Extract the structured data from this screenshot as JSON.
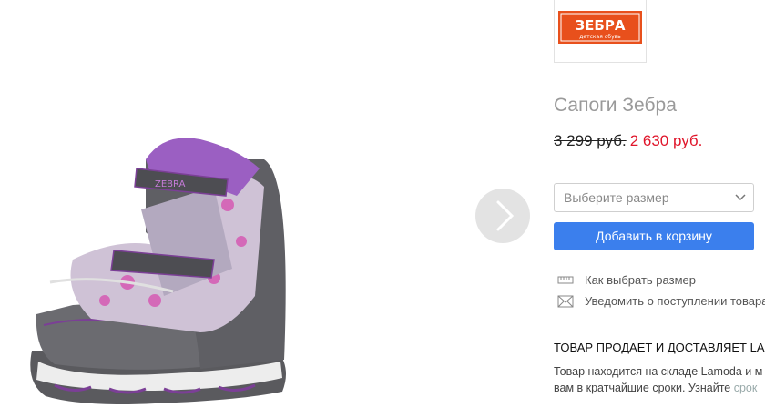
{
  "brand": {
    "logo_text": "ЗЕБРА",
    "logo_sub": "детская обувь"
  },
  "product": {
    "title": "Сапоги Зебра",
    "old_price": "3 299 руб.",
    "new_price": "2 630 руб.",
    "boot_label": "ZEBRA"
  },
  "size_select": {
    "placeholder": "Выберите размер"
  },
  "cart_button": {
    "label": "Добавить в корзину"
  },
  "links": [
    {
      "icon": "ruler-icon",
      "label": "Как выбрать размер"
    },
    {
      "icon": "envelope-icon",
      "label": "Уведомить о поступлении товара"
    }
  ],
  "seller": {
    "title": "ТОВАР ПРОДАЕТ И ДОСТАВЛЯЕТ LAMODA",
    "line1": "Товар находится на складе Lamoda и м",
    "line2_prefix": "вам в кратчайшие сроки. Узнайте ",
    "line2_link": "срок"
  },
  "colors": {
    "accent": "#3b7fed",
    "sale": "#e0162b",
    "logo_bg": "#e8501c"
  }
}
